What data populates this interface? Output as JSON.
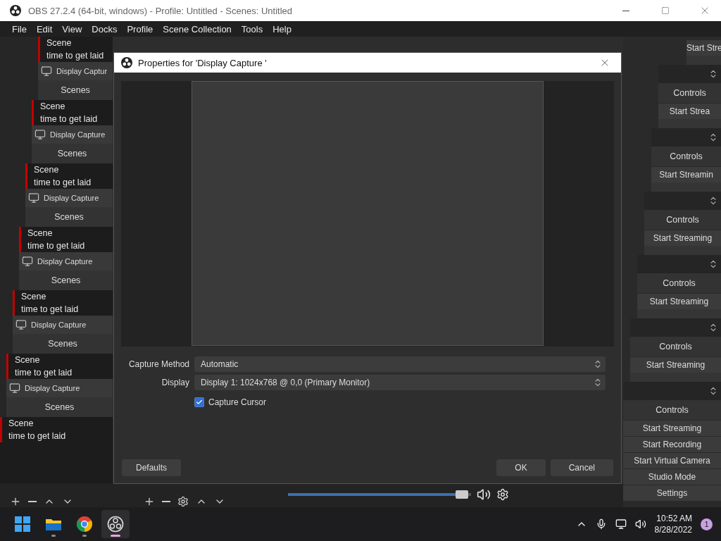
{
  "window": {
    "title": "OBS 27.2.4 (64-bit, windows) - Profile: Untitled - Scenes: Untitled"
  },
  "menu": [
    "File",
    "Edit",
    "View",
    "Docks",
    "Profile",
    "Scene Collection",
    "Tools",
    "Help"
  ],
  "scenes_cascade": [
    {
      "items": [
        "Scene",
        "time to get laid"
      ],
      "source": "Display Captur",
      "header": "Scenes"
    },
    {
      "items": [
        "Scene",
        "time to get laid"
      ],
      "source": "Display Capture",
      "header": "Scenes"
    },
    {
      "items": [
        "Scene",
        "time to get laid"
      ],
      "source": "Display Capture",
      "header": "Scenes"
    },
    {
      "items": [
        "Scene",
        "time to get laid"
      ],
      "source": "Display Capture",
      "header": "Scenes"
    },
    {
      "items": [
        "Scene",
        "time to get laid"
      ],
      "source": "Display Capture",
      "header": "Scenes"
    },
    {
      "items": [
        "Scene",
        "time to get laid"
      ],
      "source": "Display Capture",
      "header": "Scenes"
    },
    {
      "items": [
        "Scene",
        "time to get laid"
      ]
    }
  ],
  "controls_cascade": {
    "top_button": "Start Stre",
    "levels": [
      {
        "header": "Controls",
        "buttons": [
          "Start Strea"
        ]
      },
      {
        "header": "Controls",
        "buttons": [
          "Start Streamin"
        ]
      },
      {
        "header": "Controls",
        "buttons": [
          "Start Streaming"
        ]
      },
      {
        "header": "Controls",
        "buttons": [
          "Start Streaming"
        ]
      },
      {
        "header": "Controls",
        "buttons": [
          "Start Streaming"
        ]
      },
      {
        "header": "Controls",
        "buttons": [
          "Start Streaming",
          "Start Recording",
          "Start Virtual Camera",
          "Studio Mode",
          "Settings"
        ]
      }
    ]
  },
  "dialog": {
    "title": "Properties for 'Display Capture '",
    "fields": [
      {
        "label": "Capture Method",
        "value": "Automatic"
      },
      {
        "label": "Display",
        "value": "Display 1: 1024x768 @ 0,0 (Primary Monitor)"
      }
    ],
    "checkbox": {
      "label": "Capture Cursor",
      "checked": true
    },
    "buttons": [
      {
        "label": "Defaults",
        "kind": "left"
      },
      {
        "label": "OK",
        "kind": "right"
      },
      {
        "label": "Cancel",
        "kind": "right"
      }
    ]
  },
  "mixer": {
    "level": 0.95
  },
  "taskbar": {
    "apps": [
      {
        "kind": "explorer",
        "selected": false
      },
      {
        "kind": "browser",
        "selected": false
      },
      {
        "kind": "obs",
        "selected": true
      }
    ],
    "time": "10:52 AM",
    "date": "8/28/2022",
    "badge": "1"
  }
}
